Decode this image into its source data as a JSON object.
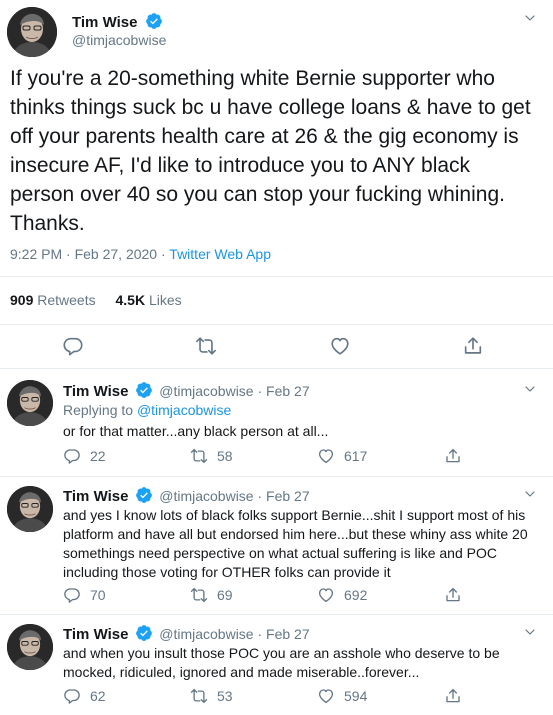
{
  "main_tweet": {
    "author_name": "Tim Wise",
    "author_handle": "@timjacobwise",
    "text": "If you're a 20-something white Bernie supporter who thinks things suck bc u have college loans & have to get off your parents health care at 26 & the gig economy is insecure AF, I'd like to introduce you to ANY black person over 40 so you can stop your fucking whining. Thanks.",
    "time": "9:22 PM · Feb 27, 2020",
    "separator": " · ",
    "source": "Twitter Web App",
    "retweets_count": "909",
    "retweets_label": "Retweets",
    "likes_count": "4.5K",
    "likes_label": "Likes"
  },
  "replies": [
    {
      "author_name": "Tim Wise",
      "author_handle": "@timjacobwise",
      "date": "Feb 27",
      "replying_prefix": "Replying to ",
      "replying_to": "@timjacobwise",
      "text": "or for that matter...any black person at all...",
      "reply_count": "22",
      "retweet_count": "58",
      "like_count": "617"
    },
    {
      "author_name": "Tim Wise",
      "author_handle": "@timjacobwise",
      "date": "Feb 27",
      "text": "and yes I know lots of black folks support Bernie...shit I support most of his platform and have all but endorsed him here...but these whiny ass white 20 somethings need perspective on what actual suffering is like and POC including those voting for OTHER folks can provide it",
      "reply_count": "70",
      "retweet_count": "69",
      "like_count": "692"
    },
    {
      "author_name": "Tim Wise",
      "author_handle": "@timjacobwise",
      "date": "Feb 27",
      "text": "and when you insult those POC you are an asshole who deserve to be mocked, ridiculed, ignored and made miserable..forever...",
      "reply_count": "62",
      "retweet_count": "53",
      "like_count": "594"
    }
  ],
  "colors": {
    "text": "#14171a",
    "muted": "#657786",
    "link": "#1b95e0",
    "divider": "#e6ecf0",
    "verified": "#1da1f2"
  }
}
